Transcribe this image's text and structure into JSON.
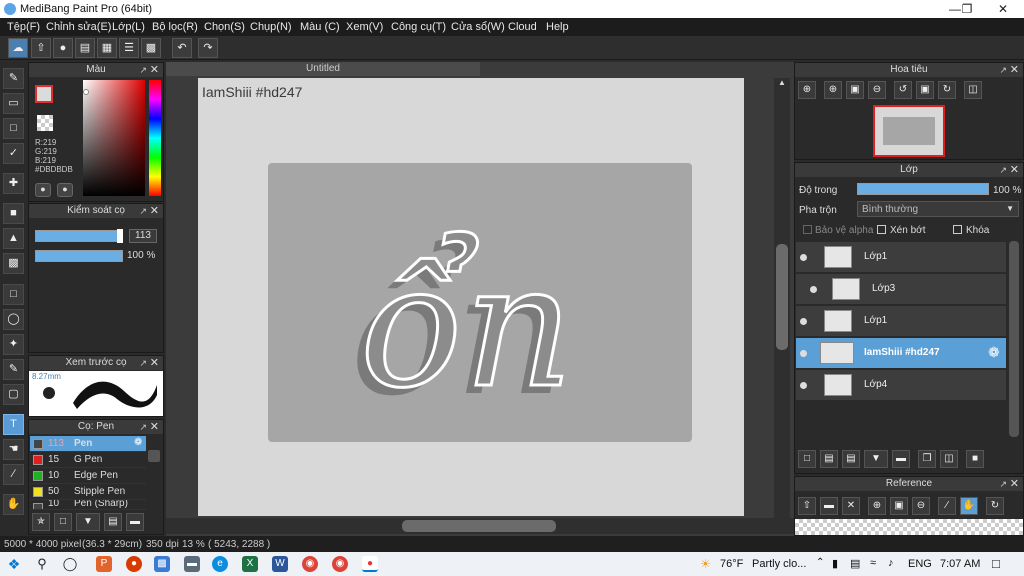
{
  "window": {
    "title": "MediBang Paint Pro (64bit)"
  },
  "menu": [
    "Tệp(F)",
    "Chỉnh sửa(E)",
    "Lớp(L)",
    "Bộ lọc(R)",
    "Chọn(S)",
    "Chụp(N)",
    "Màu (C)",
    "Xem(V)",
    "Công cụ(T)",
    "Cửa sổ(W)",
    "Cloud",
    "Help"
  ],
  "panels": {
    "color": {
      "title": "Màu",
      "r": "R:219",
      "g": "G:219",
      "b": "B:219",
      "hex": "#DBDBDB"
    },
    "brush_control": {
      "title": "Kiểm soát cọ",
      "size": "113",
      "opacity": "100 %"
    },
    "brush_preview": {
      "title": "Xem trước cọ",
      "size": "8.27mm"
    },
    "brush": {
      "title": "Cọ: Pen"
    },
    "navigator": {
      "title": "Hoa tiêu"
    },
    "layer": {
      "title": "Lớp",
      "opacity_label": "Độ trong",
      "opacity_value": "100 %",
      "blend_label": "Pha trộn",
      "blend_value": "Bình thường",
      "alpha_protect": "Bảo vệ alpha",
      "clipping": "Xén bớt",
      "lock": "Khóa"
    },
    "reference": {
      "title": "Reference"
    }
  },
  "brushes": [
    {
      "size": "113",
      "name": "Pen",
      "color": "#444444",
      "selected": true
    },
    {
      "size": "15",
      "name": "G Pen",
      "color": "#e02020",
      "selected": false
    },
    {
      "size": "10",
      "name": "Edge Pen",
      "color": "#20b020",
      "selected": false
    },
    {
      "size": "50",
      "name": "Stipple Pen",
      "color": "#f0e020",
      "selected": false
    },
    {
      "size": "10",
      "name": "Pen (Sharp)",
      "color": "#444444",
      "selected": false
    }
  ],
  "layers": [
    {
      "name": "Lớp1",
      "selected": false,
      "indent": false
    },
    {
      "name": "Lớp3",
      "selected": false,
      "indent": true
    },
    {
      "name": "Lớp1",
      "selected": false,
      "indent": false
    },
    {
      "name": "IamShiii #hd247",
      "selected": true,
      "indent": false
    },
    {
      "name": "Lớp4",
      "selected": false,
      "indent": false
    }
  ],
  "document": {
    "tab": "Untitled",
    "watermark": "IamShiii #hd247",
    "artwork_text": "ổn"
  },
  "status": {
    "size": "5000 * 4000 pixel",
    "physical": "(36.3 * 29cm)",
    "dpi": "350 dpi",
    "zoom": "13 %",
    "coords": "( 5243, 2288 )"
  },
  "taskbar": {
    "weather_temp": "76°F",
    "weather_text": "Partly clo...",
    "lang": "ENG",
    "time": "7:07 AM"
  },
  "colors": {
    "accent": "#5b9fd7",
    "panel": "#2a2a2a",
    "canvas_bg": "#d8d8d8"
  }
}
